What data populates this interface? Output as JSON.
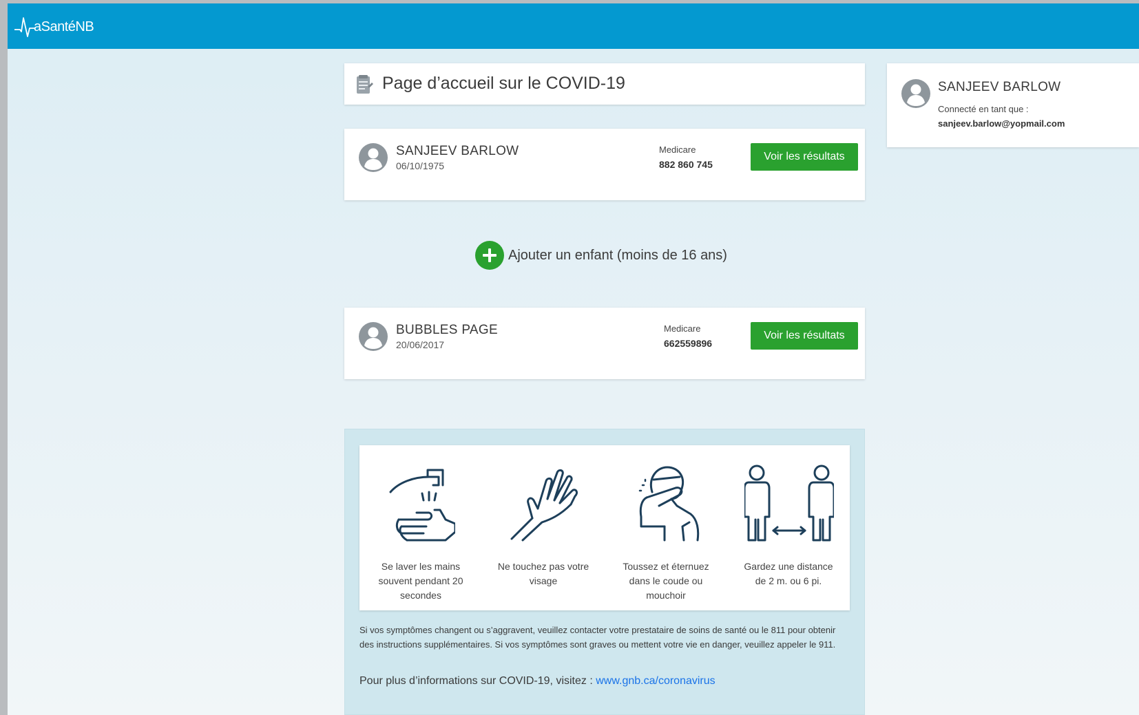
{
  "app": {
    "logo_text": "aSantéNB",
    "brand_color": "#0499d0"
  },
  "page": {
    "title": "Page d’accueil sur le COVID-19"
  },
  "account": {
    "name": "SANJEEV BARLOW",
    "connected_label": "Connecté en tant que :",
    "email": "sanjeev.barlow@yopmail.com"
  },
  "persons": [
    {
      "name": "SANJEEV BARLOW",
      "dob": "06/10/1975",
      "medicare_label": "Medicare",
      "medicare_number": "882 860 745",
      "results_label": "Voir les résultats"
    },
    {
      "name": "BUBBLES PAGE",
      "dob": "20/06/2017",
      "medicare_label": "Medicare",
      "medicare_number": "662559896",
      "results_label": "Voir les résultats"
    }
  ],
  "add_child": {
    "label": "Ajouter un enfant (moins de 16 ans)",
    "icon": "plus-circle-icon",
    "color": "#2aa12f"
  },
  "tips": [
    {
      "icon": "hand-washing-icon",
      "label": "Se laver les mains souvent pendant 20 secondes"
    },
    {
      "icon": "hand-no-touch-icon",
      "label": "Ne touchez pas votre visage"
    },
    {
      "icon": "cough-elbow-icon",
      "label": "Toussez et éternuez dans le coude ou mouchoir"
    },
    {
      "icon": "social-distance-icon",
      "label": "Gardez une distance de 2 m. ou 6 pi."
    }
  ],
  "notice": "Si vos symptômes changent ou s’aggravent, veuillez contacter votre prestataire de soins de santé ou le 811 pour obtenir des instructions supplémentaires. Si vos symptômes sont graves ou mettent votre vie en danger, veuillez appeler le 911.",
  "more_info": {
    "prefix": "Pour plus d’informations sur COVID-19, visitez : ",
    "link_text": "www.gnb.ca/coronavirus"
  }
}
